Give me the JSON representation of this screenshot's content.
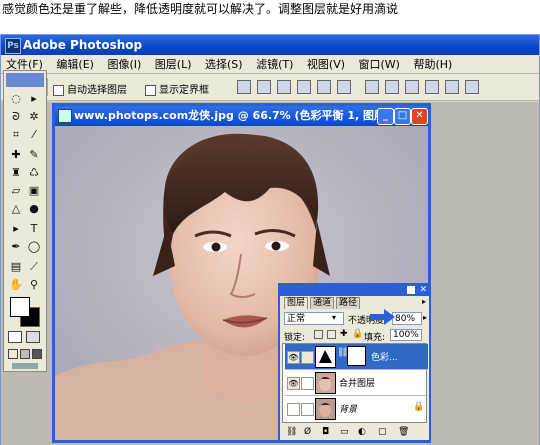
{
  "caption": "感觉颜色还是重了解些，降低透明度就可以解决了。调整图层就是好用滴说",
  "app": {
    "title": "Adobe Photoshop",
    "menu": [
      "文件(F)",
      "编辑(E)",
      "图像(I)",
      "图层(L)",
      "选择(S)",
      "滤镜(T)",
      "视图(V)",
      "窗口(W)",
      "帮助(H)"
    ],
    "options": {
      "auto_select": "自动选择图层",
      "show_bounds": "显示定界框"
    }
  },
  "document": {
    "title": "www.photops.com龙侠.jpg @ 66.7% (色彩平衡 1, 图层蒙版/8)"
  },
  "layers_panel": {
    "tabs": [
      "图层",
      "通道",
      "路径"
    ],
    "blend_mode": "正常",
    "opacity_label": "不透明度",
    "opacity_value": "80%",
    "lock_label": "锁定:",
    "fill_label": "填充:",
    "fill_value": "100%",
    "layers": [
      {
        "name": "色彩...",
        "selected": true
      },
      {
        "name": "合并图层",
        "selected": false
      },
      {
        "name": "背景",
        "selected": false
      }
    ]
  },
  "colors": {
    "accent": "#2a5fd6",
    "selected_row": "#316ac5"
  }
}
